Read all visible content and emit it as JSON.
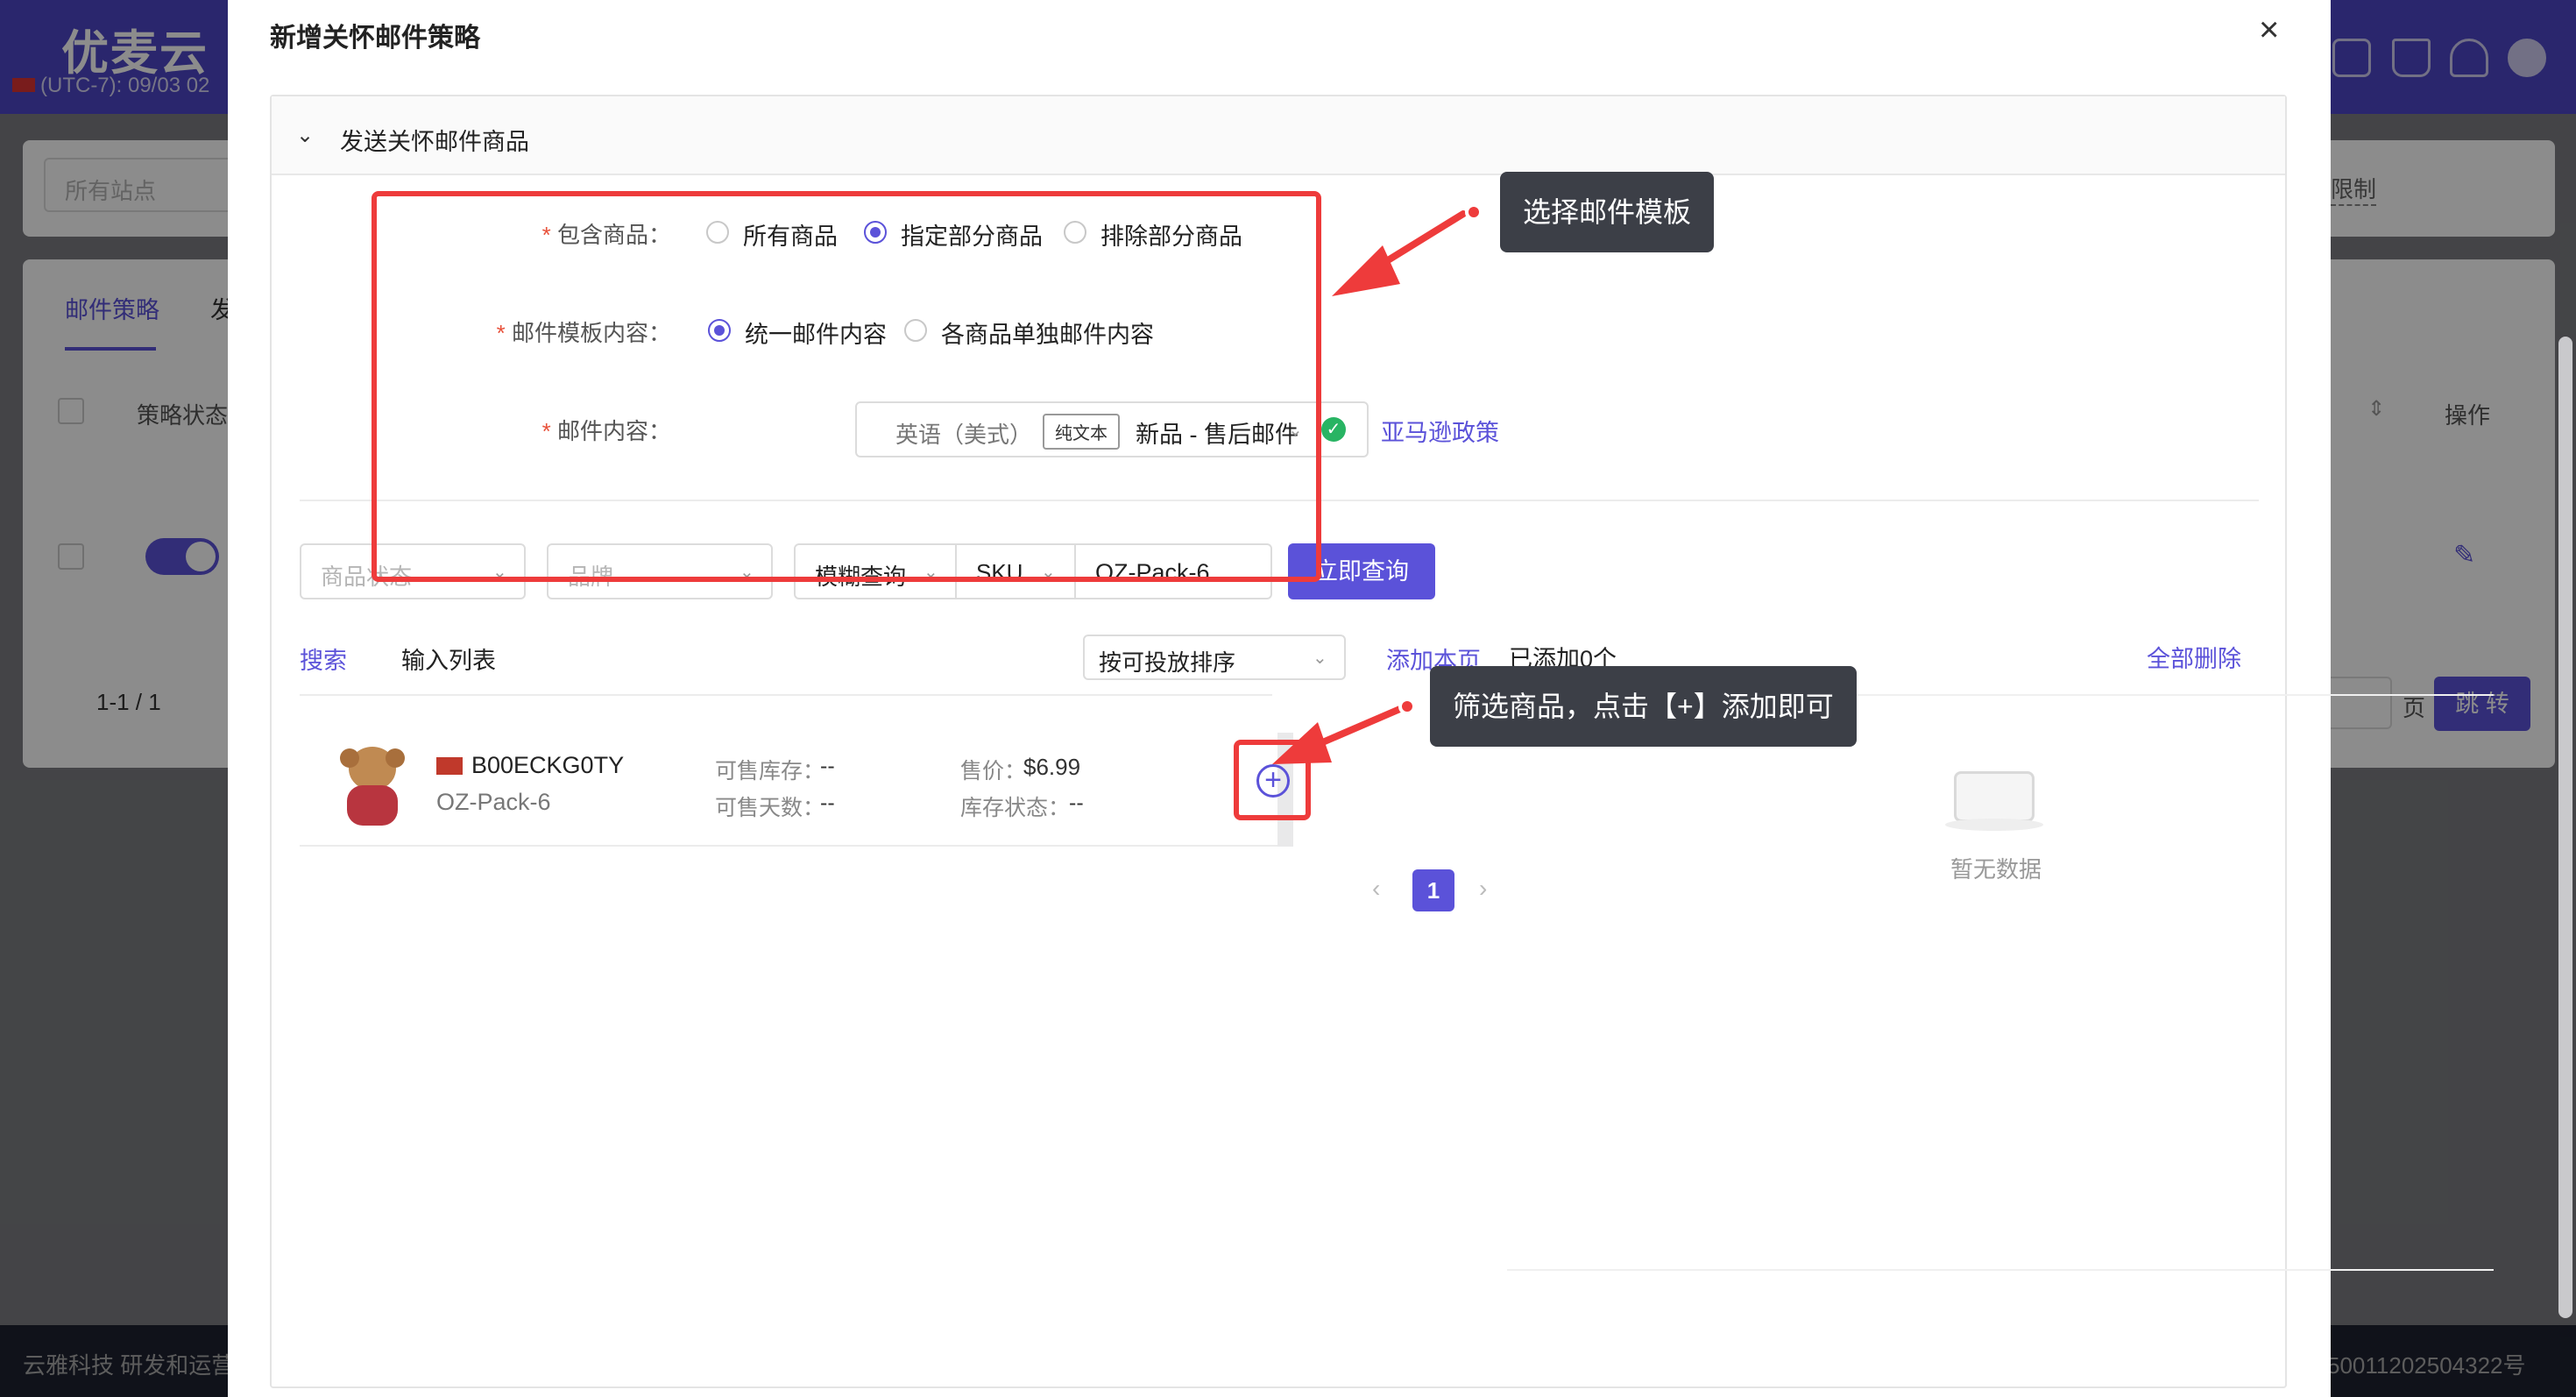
{
  "background": {
    "logo": "优麦云",
    "timezone": "(UTC-7): 09/03 02",
    "site_placeholder": "所有站点",
    "tab_strategy": "邮件策略",
    "tab_other": "发",
    "col_status": "策略状态",
    "col_action": "操作",
    "limit_text": "限制",
    "pagination": "1-1 / 1",
    "page_unit": "页",
    "jump_label": "跳 转",
    "footer_left": "云雅科技 研发和运营",
    "footer_right": "50011202504322号"
  },
  "modal": {
    "title": "新增关怀邮件策略",
    "close": "×",
    "section_title": "发送关怀邮件商品",
    "include_label": "包含商品：",
    "include_options": [
      "所有商品",
      "指定部分商品",
      "排除部分商品"
    ],
    "include_selected": "指定部分商品",
    "template_label": "邮件模板内容：",
    "template_options": [
      "统一邮件内容",
      "各商品单独邮件内容"
    ],
    "template_selected": "统一邮件内容",
    "content_label": "邮件内容：",
    "language": "英语（美式）",
    "plain_text_tag": "纯文本",
    "template_name": "新品 - 售后邮件",
    "policy_link": "亚马逊政策",
    "filters": {
      "status_placeholder": "商品状态",
      "brand_placeholder": "品牌",
      "match_mode": "模糊查询",
      "field": "SKU",
      "search_value": "OZ-Pack-6",
      "query_button": "立即查询"
    },
    "left_tabs": [
      "搜索",
      "输入列表"
    ],
    "sort_option": "按可投放排序",
    "add_page": "添加本页",
    "added_count": "已添加0个",
    "delete_all": "全部删除",
    "product": {
      "asin": "B00ECKG0TY",
      "sku": "OZ-Pack-6",
      "stock_label": "可售库存：",
      "stock_value": "--",
      "days_label": "可售天数：",
      "days_value": "--",
      "price_label": "售价：",
      "price_value": "$6.99",
      "stock_status_label": "库存状态：",
      "stock_status_value": "--"
    },
    "page_current": "1",
    "empty_text": "暂无数据"
  },
  "callouts": {
    "template": "选择邮件模板",
    "add": "筛选商品，点击【+】添加即可"
  },
  "colors": {
    "primary": "#5b52d9",
    "annotation_red": "#ee3b3b",
    "callout_bg": "#3c3f47",
    "success": "#28b463"
  }
}
